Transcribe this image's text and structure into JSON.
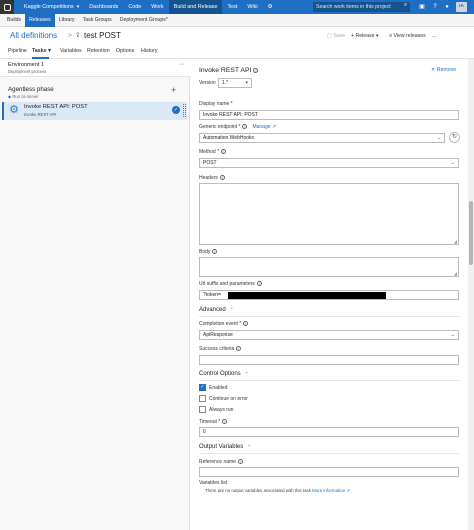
{
  "topbar": {
    "project": "Kaggle Competitions",
    "nav": [
      "Dashboards",
      "Code",
      "Work",
      "Build and Release",
      "Test",
      "Wiki"
    ],
    "active_nav": "Build and Release",
    "search_placeholder": "Search work items in this project",
    "avatar": "IA"
  },
  "subnav": {
    "items": [
      "Builds",
      "Releases",
      "Library",
      "Task Groups",
      "Deployment Groups*"
    ],
    "active": "Releases"
  },
  "titlebar": {
    "breadcrumb": "All definitions",
    "separator": ">",
    "title": "test POST",
    "save": "Save",
    "release": "Release",
    "view_releases": "View releases",
    "more": "..."
  },
  "tabs": [
    "Pipeline",
    "Tasks",
    "Variables",
    "Retention",
    "Options",
    "History"
  ],
  "tasks_tab_suffix": "▾",
  "left": {
    "environment_title": "Environment 1",
    "environment_sub": "Deployment process",
    "phase_title": "Agentless phase",
    "phase_sub": "Run on server",
    "task_title": "Invoke REST API: POST",
    "task_sub": "Invoke REST API"
  },
  "panel": {
    "title": "Invoke REST API",
    "remove": "Remove",
    "version_label": "Version",
    "version_value": "1.*",
    "display_name_label": "Display name",
    "display_name_value": "Invoke REST API: POST",
    "endpoint_label": "Generic endpoint",
    "manage": "Manage",
    "endpoint_value": "Automation WebHooks",
    "method_label": "Method",
    "method_value": "POST",
    "headers_label": "Headers",
    "body_label": "Body",
    "url_label": "Url suffix and parameters",
    "url_value": "?token=",
    "advanced_label": "Advanced",
    "completion_label": "Completion event",
    "completion_value": "ApiResponse",
    "success_label": "Success criteria",
    "control_label": "Control Options",
    "enabled": "Enabled",
    "continue_on_error": "Continue on error",
    "always_run": "Always run",
    "timeout_label": "Timeout",
    "timeout_value": "0",
    "output_label": "Output Variables",
    "reference_label": "Reference name",
    "variables_list_label": "Variables list",
    "variables_note": "There are no output variables associated with this task",
    "more_info": "More information"
  }
}
